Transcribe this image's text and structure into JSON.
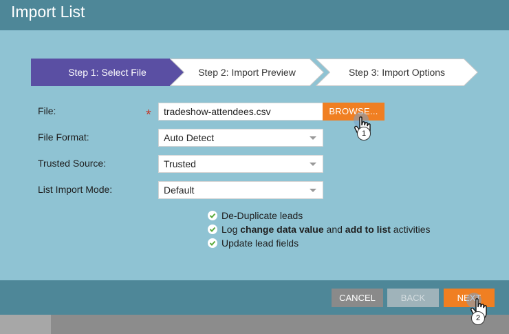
{
  "dialog": {
    "title": "Import List"
  },
  "steps": [
    {
      "label": "Step 1: Select File",
      "active": true
    },
    {
      "label": "Step 2: Import Preview",
      "active": false
    },
    {
      "label": "Step 3: Import Options",
      "active": false
    }
  ],
  "form": {
    "file_label": "File:",
    "file_value": "tradeshow-attendees.csv",
    "required_mark": "*",
    "browse_label": "BROWSE...",
    "format_label": "File Format:",
    "format_value": "Auto Detect",
    "trusted_label": "Trusted Source:",
    "trusted_value": "Trusted",
    "mode_label": "List Import Mode:",
    "mode_value": "Default"
  },
  "options": {
    "dedupe": "De-Duplicate leads",
    "log_prefix": "Log ",
    "log_bold1": "change data value",
    "log_mid": " and ",
    "log_bold2": "add to list",
    "log_suffix": " activities",
    "update": "Update lead fields"
  },
  "buttons": {
    "cancel": "CANCEL",
    "back": "BACK",
    "next": "NEXT"
  },
  "callouts": {
    "one": "1",
    "two": "2"
  },
  "colors": {
    "header": "#4e8798",
    "body": "#8fc3d3",
    "active_step": "#5a4fa3",
    "accent": "#f07f22"
  },
  "icons": {
    "check": "check-circle-icon",
    "cursor": "hand-pointer-icon",
    "dropdown": "chevron-down-icon"
  }
}
